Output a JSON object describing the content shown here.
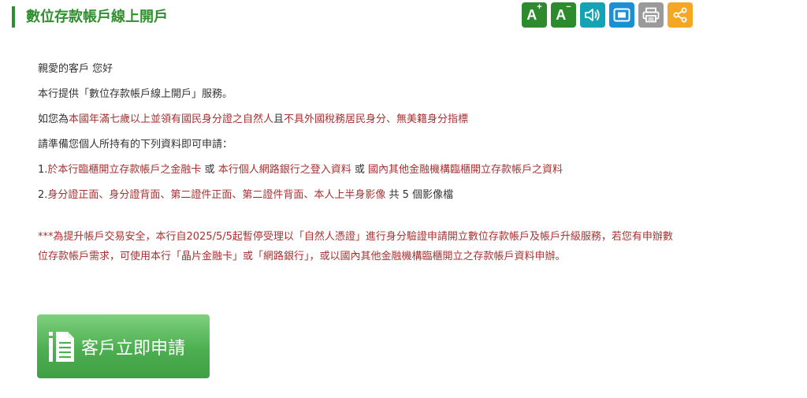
{
  "page": {
    "title": "數位存款帳戶線上開戶"
  },
  "toolbar": {
    "font_increase_label": "A",
    "font_increase_sup": "+",
    "font_decrease_label": "A",
    "font_decrease_sup": "−",
    "icons": [
      "font-increase-icon",
      "font-decrease-icon",
      "speaker-icon",
      "screen-icon",
      "print-icon",
      "share-icon"
    ],
    "colors": {
      "green": "#2d8a2d",
      "teal": "#13a3b5",
      "blue": "#1a8fd6",
      "gray": "#9a9a9a",
      "orange": "#f5a623"
    }
  },
  "content": {
    "greeting": "親愛的客戶 您好",
    "service_line": "本行提供「數位存款帳戶線上開戶」服務。",
    "eligibility_prefix": "如您為",
    "eligibility_red1": "本國年滿七歲以上並領有國民身分證之自然人",
    "eligibility_mid": "且",
    "eligibility_red2": "不具外國稅務居民身分、無美籍身分指標",
    "prepare": "請準備您個人所持有的下列資料即可申請：",
    "item1_prefix": "1.",
    "item1_red1": "於本行臨櫃開立存款帳戶之金融卡",
    "item1_or1": " 或 ",
    "item1_red2": "本行個人網路銀行之登入資料",
    "item1_or2": " 或 ",
    "item1_red3": "國內其他金融機構臨櫃開立存款帳戶之資料",
    "item2_prefix": "2.",
    "item2_red": "身分證正面、身分證背面、第二證件正面、第二證件背面、本人上半身影像",
    "item2_suffix": " 共 5 個影像檔",
    "notice": "***為提升帳戶交易安全，本行自2025/5/5起暫停受理以「自然人憑證」進行身分驗證申請開立數位存款帳戶及帳戶升級服務，若您有申辦數位存款帳戶需求，可使用本行「晶片金融卡」或「網路銀行」，或以國內其他金融機構臨櫃開立之存款帳戶資料申辦。"
  },
  "apply_button": {
    "label": "客戶立即申請",
    "color": "#4caf50"
  }
}
